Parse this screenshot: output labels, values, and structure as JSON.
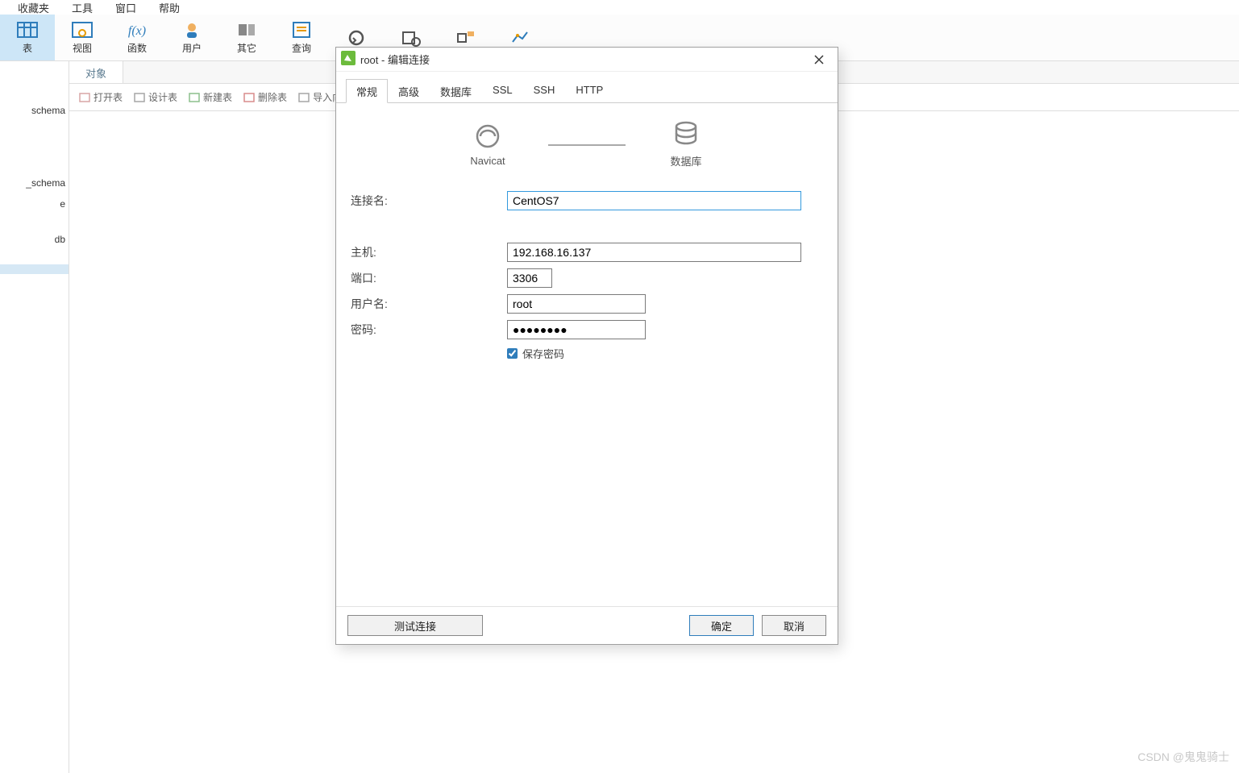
{
  "menubar": {
    "items": [
      "收藏夹",
      "工具",
      "窗口",
      "帮助"
    ]
  },
  "ribbon": {
    "items": [
      {
        "label": "表",
        "selected": true
      },
      {
        "label": "视图"
      },
      {
        "label": "函数"
      },
      {
        "label": "用户"
      },
      {
        "label": "其它"
      },
      {
        "label": "查询"
      },
      {
        "label": "",
        "icon": "backup"
      },
      {
        "label": "",
        "icon": "schedule"
      },
      {
        "label": "",
        "icon": "model"
      },
      {
        "label": "",
        "icon": "chart"
      }
    ]
  },
  "sidebar": {
    "items": [
      {
        "label": "schema"
      },
      {
        "label": "_schema"
      },
      {
        "label": "e"
      },
      {
        "label": "db"
      },
      {
        "label": "",
        "selected": true
      }
    ]
  },
  "content": {
    "tab_label": "对象",
    "subtoolbar": [
      "打开表",
      "设计表",
      "新建表",
      "删除表",
      "导入向"
    ]
  },
  "dialog": {
    "title": "root - 编辑连接",
    "tabs": [
      "常规",
      "高级",
      "数据库",
      "SSL",
      "SSH",
      "HTTP"
    ],
    "diagram": {
      "left": "Navicat",
      "right": "数据库"
    },
    "fields": {
      "conn_name_label": "连接名:",
      "conn_name_value": "CentOS7",
      "host_label": "主机:",
      "host_value": "192.168.16.137",
      "port_label": "端口:",
      "port_value": "3306",
      "user_label": "用户名:",
      "user_value": "root",
      "pwd_label": "密码:",
      "pwd_value": "●●●●●●●●",
      "save_pwd_label": "保存密码"
    },
    "buttons": {
      "test": "测试连接",
      "ok": "确定",
      "cancel": "取消"
    }
  },
  "watermark": "CSDN @鬼鬼骑士"
}
